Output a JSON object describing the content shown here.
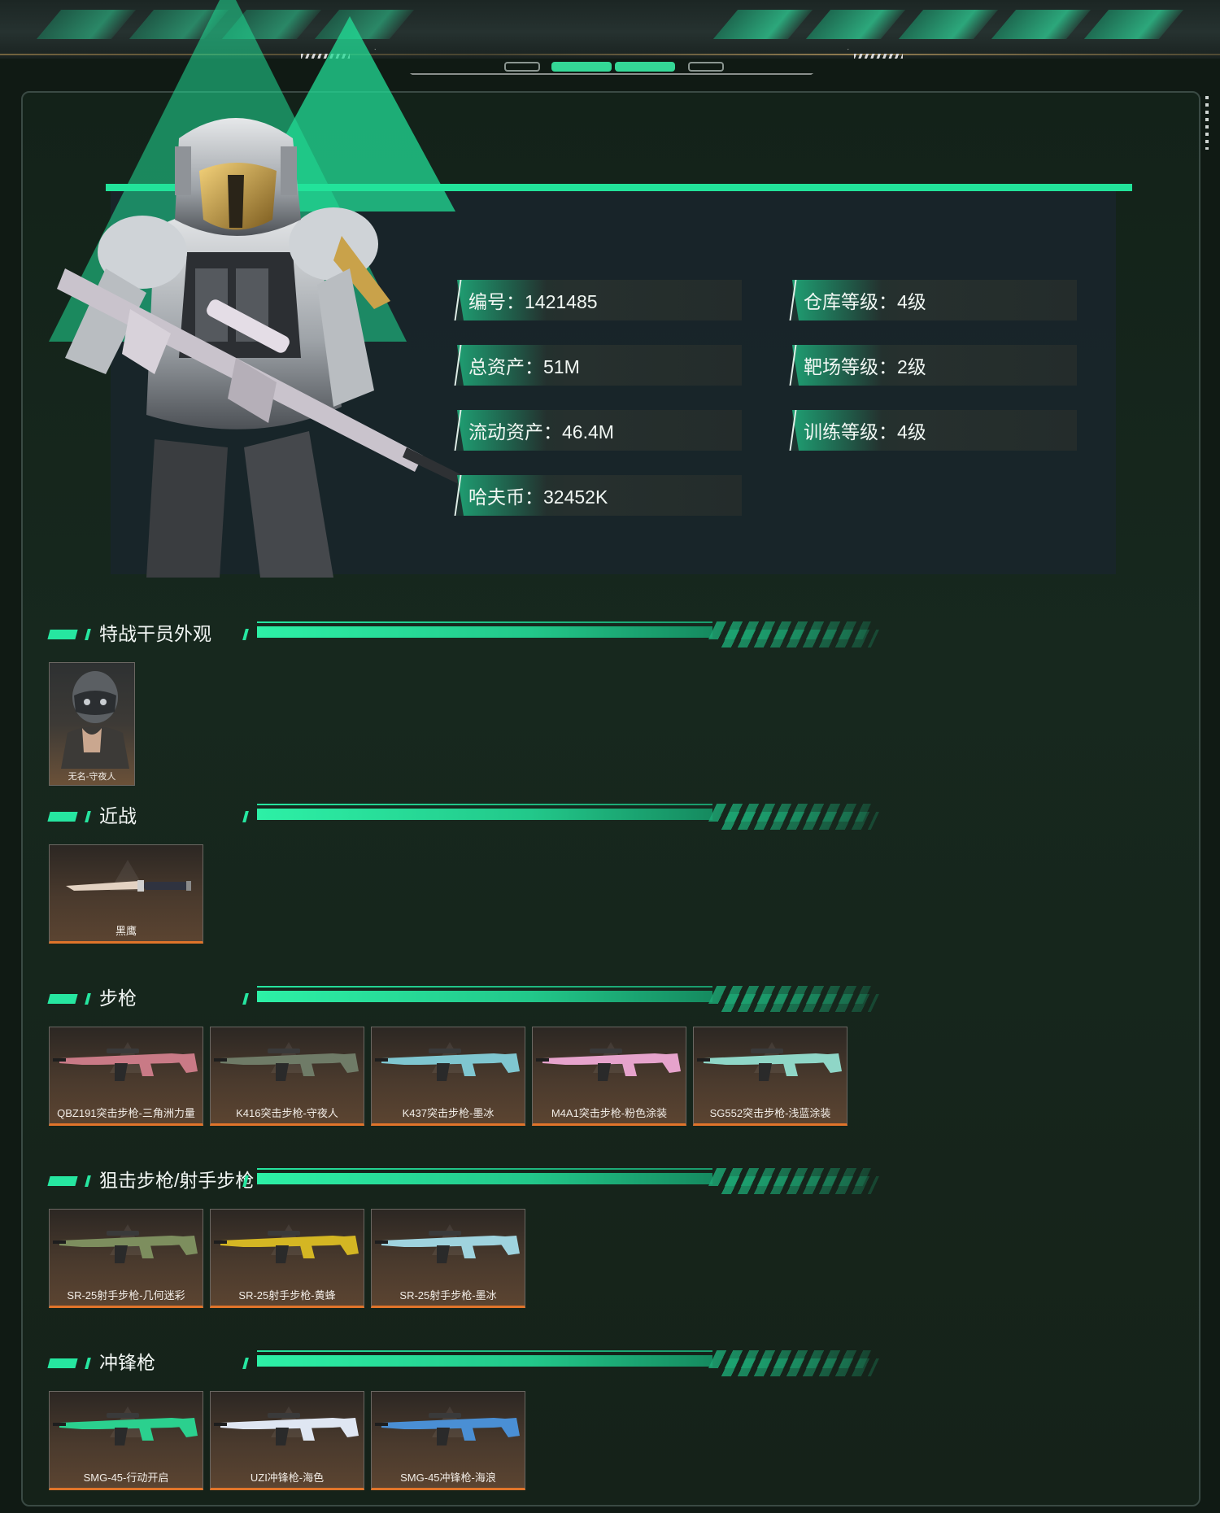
{
  "profile": {
    "stats_left": [
      {
        "label": "编号：1421485"
      },
      {
        "label": "总资产：51M"
      },
      {
        "label": "流动资产：46.4M"
      },
      {
        "label": "哈夫币：32452K"
      }
    ],
    "stats_right": [
      {
        "label": "仓库等级：4级"
      },
      {
        "label": "靶场等级：2级"
      },
      {
        "label": "训练等级：4级"
      }
    ]
  },
  "sections": [
    {
      "title": "特战干员外观",
      "items": [
        {
          "name": "无名-守夜人",
          "icon": "operator-portrait"
        }
      ]
    },
    {
      "title": "近战",
      "items": [
        {
          "name": "黑鹰",
          "icon": "knife-icon"
        }
      ]
    },
    {
      "title": "步枪",
      "items": [
        {
          "name": "QBZ191突击步枪-三角洲力量",
          "color": "#c97a86"
        },
        {
          "name": "K416突击步枪-守夜人",
          "color": "#6f7b67"
        },
        {
          "name": "K437突击步枪-墨冰",
          "color": "#7fc6d0"
        },
        {
          "name": "M4A1突击步枪-粉色涂装",
          "color": "#e6a3cc"
        },
        {
          "name": "SG552突击步枪-浅蓝涂装",
          "color": "#8fd6c7"
        }
      ]
    },
    {
      "title": "狙击步枪/射手步枪",
      "items": [
        {
          "name": "SR-25射手步枪-几何迷彩",
          "color": "#7d8e5e"
        },
        {
          "name": "SR-25射手步枪-黄蜂",
          "color": "#d4b623"
        },
        {
          "name": "SR-25射手步枪-墨冰",
          "color": "#9fd3de"
        }
      ]
    },
    {
      "title": "冲锋枪",
      "items": [
        {
          "name": "SMG-45-行动开启",
          "color": "#2bd08e"
        },
        {
          "name": "UZI冲锋枪-海色",
          "color": "#dfe6f2"
        },
        {
          "name": "SMG-45冲锋枪-海浪",
          "color": "#4a8fd4"
        }
      ]
    }
  ],
  "colors": {
    "accent": "#22e39a",
    "card_border": "#e0742a",
    "panel_bg": "#17281e"
  }
}
